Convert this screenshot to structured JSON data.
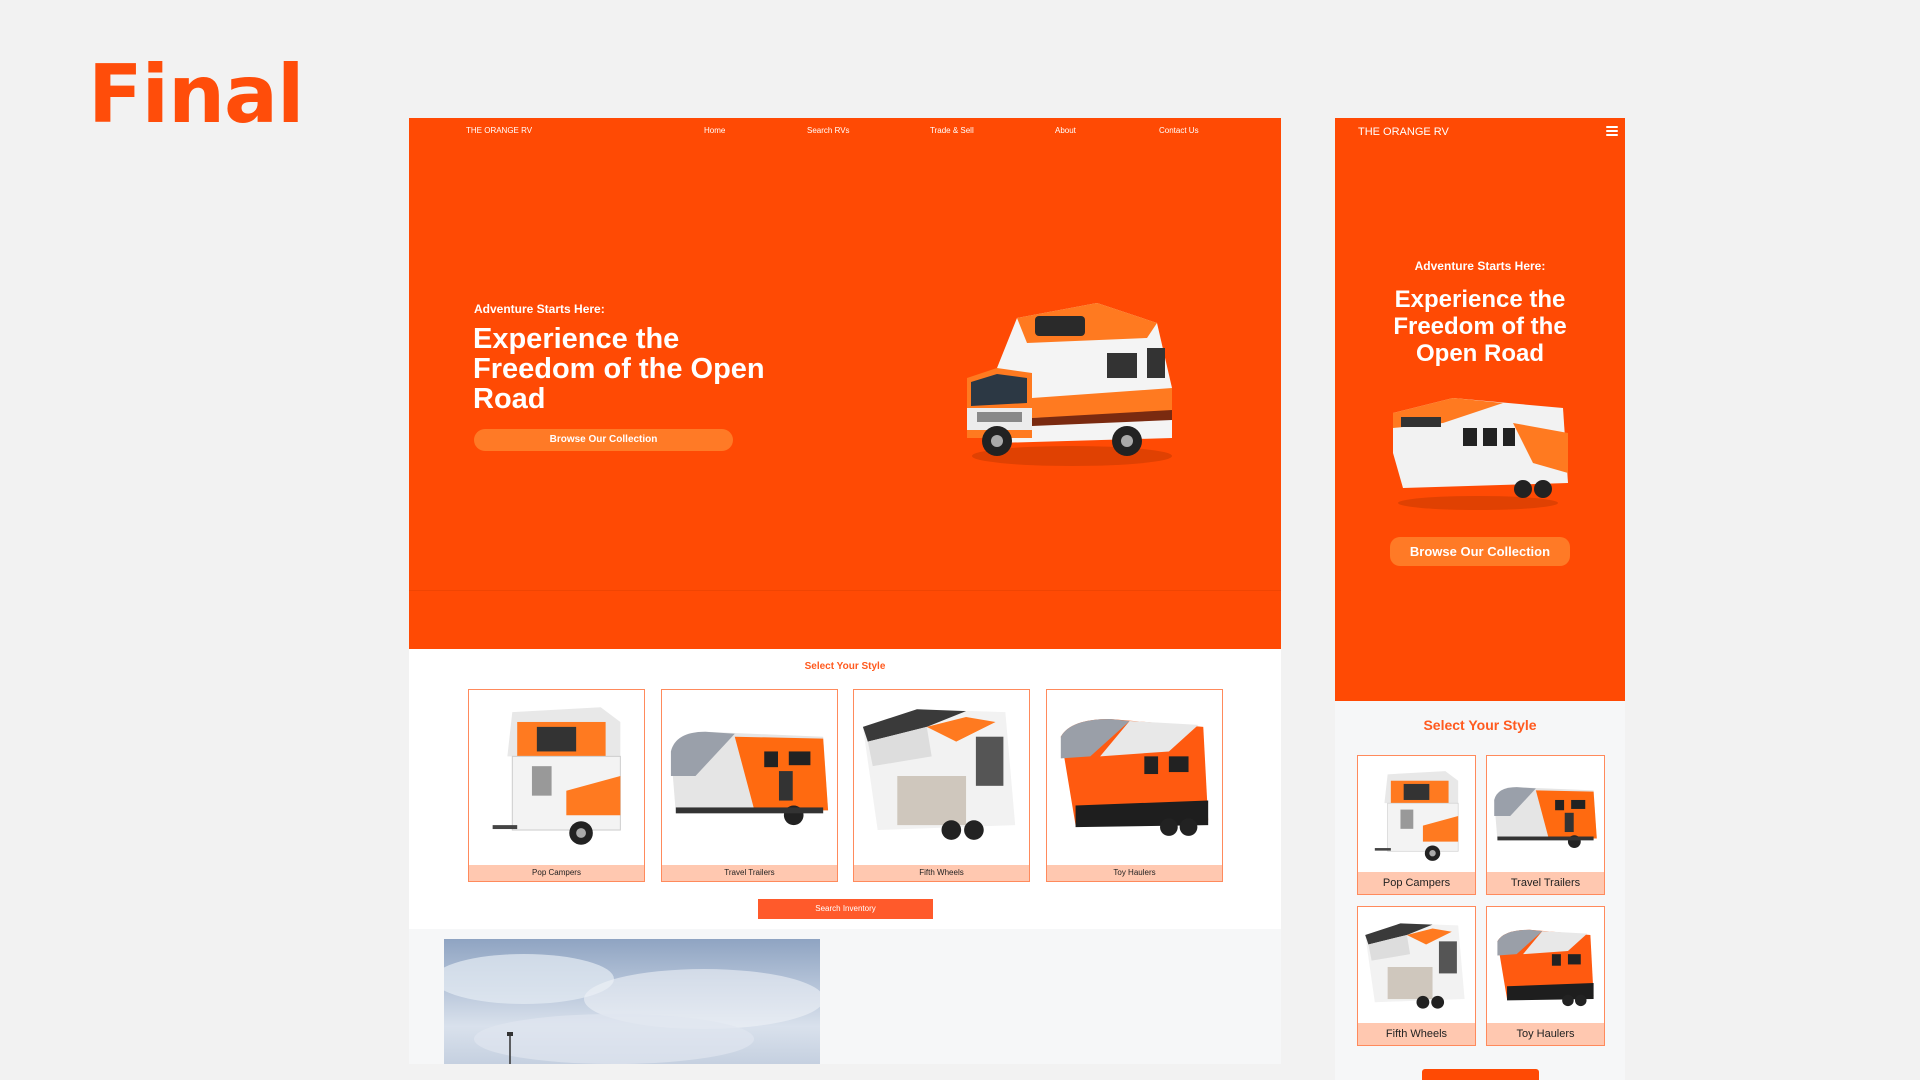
{
  "slide": {
    "title": "Final"
  },
  "desktop": {
    "nav": {
      "brand": "THE ORANGE RV",
      "links": [
        "Home",
        "Search RVs",
        "Trade & Sell",
        "About",
        "Contact Us"
      ]
    },
    "hero": {
      "eyebrow": "Adventure Starts Here:",
      "title": "Experience the Freedom of the Open Road",
      "cta": "Browse Our Collection"
    },
    "select": {
      "title": "Select Your Style",
      "cards": [
        "Pop Campers",
        "Travel Trailers",
        "Fifth Wheels",
        "Toy Haulers"
      ],
      "search_button": "Search Inventory"
    }
  },
  "mobile": {
    "brand": "THE ORANGE RV",
    "hero": {
      "eyebrow": "Adventure Starts Here:",
      "title": "Experience the Freedom of the Open Road",
      "cta": "Browse Our Collection"
    },
    "select": {
      "title": "Select Your Style",
      "cards": [
        "Pop Campers",
        "Travel Trailers",
        "Fifth Wheels",
        "Toy Haulers"
      ]
    }
  },
  "colors": {
    "accent": "#ff4a04",
    "button": "#ff7a26",
    "card_label": "#ffc8b0",
    "card_border": "#ff8a5c"
  },
  "icons": {
    "menu": "hamburger-icon"
  }
}
